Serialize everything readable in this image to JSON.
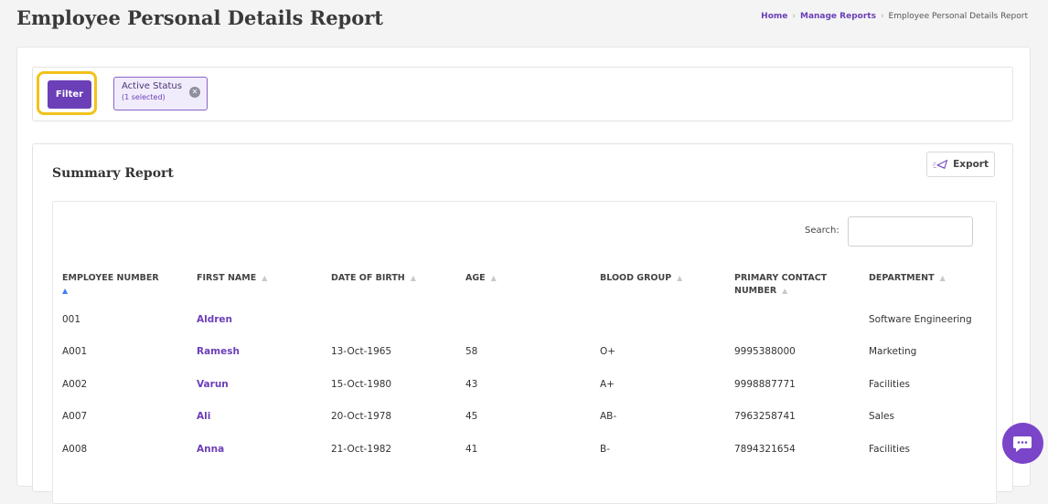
{
  "page": {
    "title": "Employee Personal Details Report",
    "breadcrumb": [
      "Home",
      "Manage Reports",
      "Employee Personal Details Report"
    ]
  },
  "filter": {
    "button_label": "Filter",
    "chip": {
      "label": "Active Status",
      "sub": "(1 selected)",
      "close_icon": "x-circle-icon"
    }
  },
  "summary": {
    "title": "Summary Report",
    "export_label": "Export",
    "search_label": "Search:",
    "search_value": "",
    "columns": [
      {
        "label": "EMPLOYEE NUMBER",
        "sort": "asc"
      },
      {
        "label": "FIRST NAME",
        "sort": "none"
      },
      {
        "label": "DATE OF BIRTH",
        "sort": "none"
      },
      {
        "label": "AGE",
        "sort": "none"
      },
      {
        "label": "BLOOD GROUP",
        "sort": "none"
      },
      {
        "label": "PRIMARY CONTACT NUMBER",
        "sort": "none"
      },
      {
        "label": "DEPARTMENT",
        "sort": "none"
      }
    ],
    "rows": [
      {
        "emp_no": "001",
        "first_name": "Aldren",
        "dob": "",
        "age": "",
        "blood": "",
        "contact": "",
        "dept": "Software Engineering"
      },
      {
        "emp_no": "A001",
        "first_name": "Ramesh",
        "dob": "13-Oct-1965",
        "age": "58",
        "blood": "O+",
        "contact": "9995388000",
        "dept": "Marketing"
      },
      {
        "emp_no": "A002",
        "first_name": "Varun",
        "dob": "15-Oct-1980",
        "age": "43",
        "blood": "A+",
        "contact": "9998887771",
        "dept": "Facilities"
      },
      {
        "emp_no": "A007",
        "first_name": "Ali",
        "dob": "20-Oct-1978",
        "age": "45",
        "blood": "AB-",
        "contact": "7963258741",
        "dept": "Sales"
      },
      {
        "emp_no": "A008",
        "first_name": "Anna",
        "dob": "21-Oct-1982",
        "age": "41",
        "blood": "B-",
        "contact": "7894321654",
        "dept": "Facilities"
      }
    ]
  },
  "colors": {
    "accent": "#6b3fb8",
    "highlight": "#f2c21b",
    "fab": "#7a45c8"
  }
}
